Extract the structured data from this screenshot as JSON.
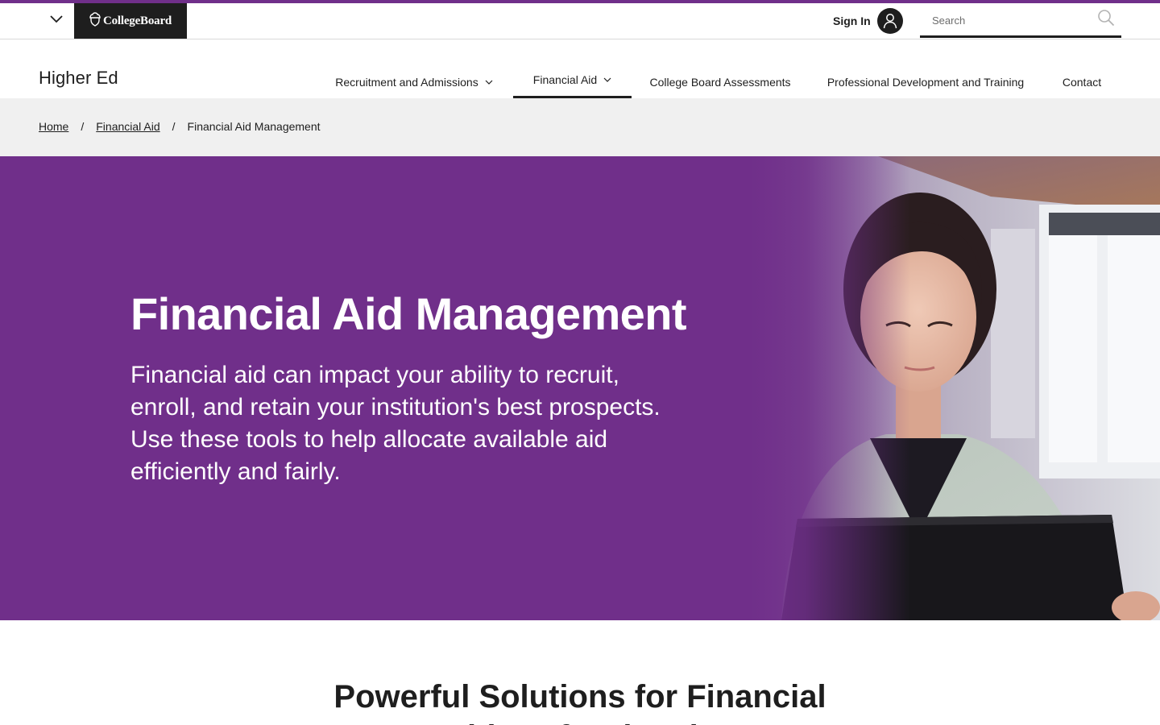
{
  "global_header": {
    "menu_icon": "chevron-down-icon",
    "logo_text": "CollegeBoard",
    "logo_icon": "acorn-icon",
    "signin_label": "Sign In",
    "avatar_icon": "user-icon",
    "search": {
      "placeholder": "Search",
      "value": "",
      "icon": "search-icon"
    },
    "accent_color": "#702f8a"
  },
  "local_nav": {
    "site_title": "Higher Ed",
    "items": [
      {
        "label": "Recruitment and Admissions",
        "has_dropdown": true,
        "active": false
      },
      {
        "label": "Financial Aid",
        "has_dropdown": true,
        "active": true
      },
      {
        "label": "College Board Assessments",
        "has_dropdown": false,
        "active": false
      },
      {
        "label": "Professional Development and Training",
        "has_dropdown": false,
        "active": false
      },
      {
        "label": "Contact",
        "has_dropdown": false,
        "active": false
      }
    ]
  },
  "breadcrumb": {
    "items": [
      {
        "label": "Home",
        "link": true
      },
      {
        "label": "Financial Aid",
        "link": true
      },
      {
        "label": "Financial Aid Management",
        "link": false
      }
    ],
    "separator": "/"
  },
  "hero": {
    "title": "Financial Aid Management",
    "description": "Financial aid can impact your ability to recruit, enroll, and retain your institution's best prospects. Use these tools to help allocate available aid efficiently and fairly.",
    "background_color": "#702f8a"
  },
  "section": {
    "heading": "Powerful Solutions for Financial Aid Professionals"
  }
}
